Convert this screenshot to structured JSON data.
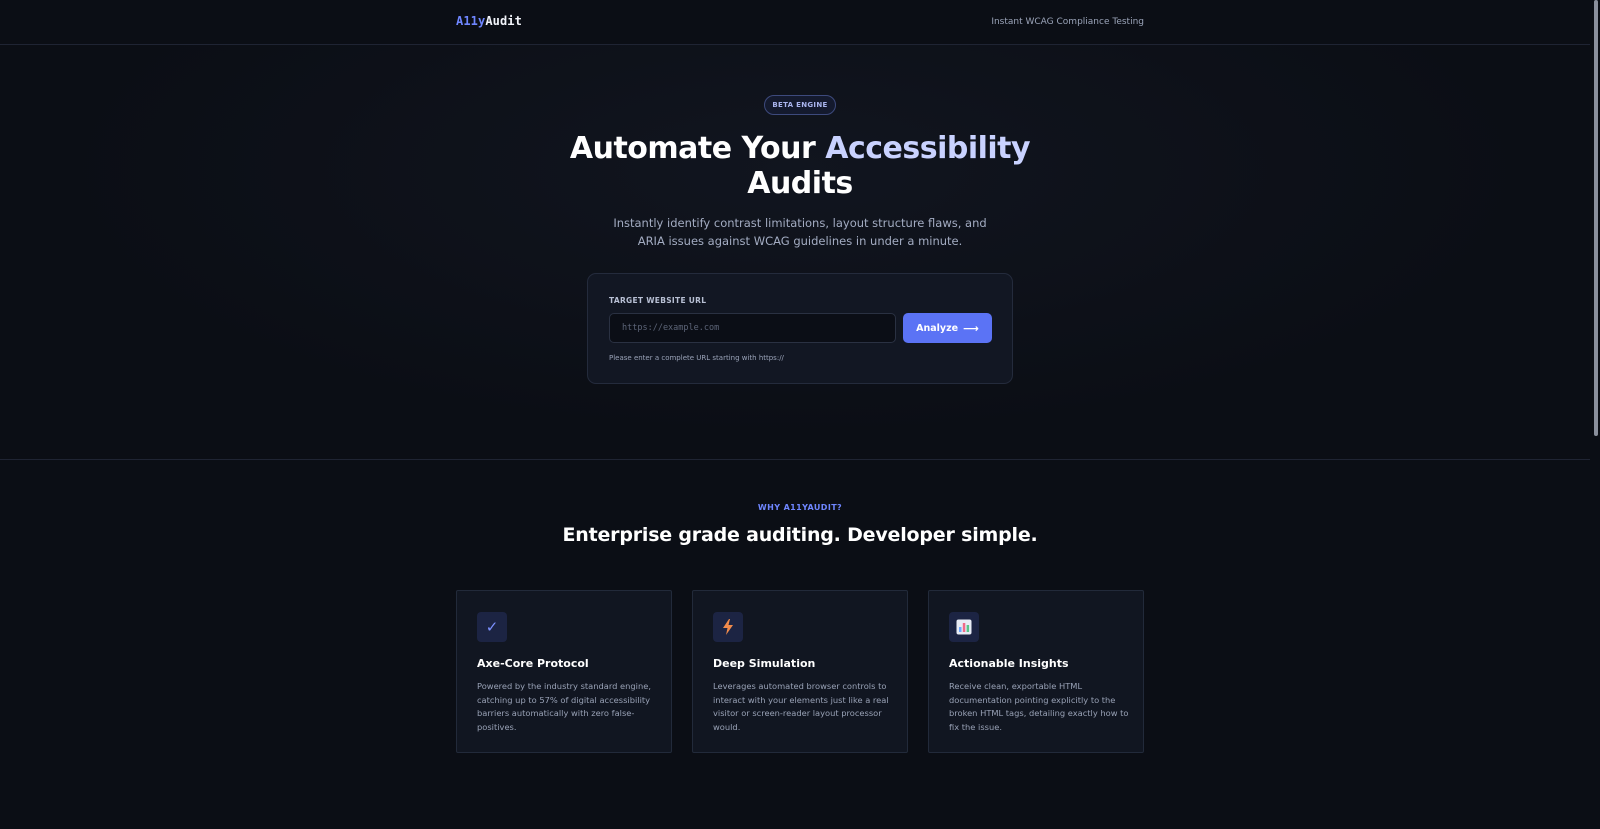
{
  "header": {
    "logo_part1": "A11y",
    "logo_part2": "Audit",
    "tagline": "Instant WCAG Compliance Testing"
  },
  "hero": {
    "badge": "BETA ENGINE",
    "headline_part1": "Automate Your ",
    "headline_highlight": "Accessibility",
    "headline_part2": "Audits",
    "subtitle": "Instantly identify contrast limitations, layout structure flaws, and ARIA issues against WCAG guidelines in under a minute."
  },
  "form": {
    "label": "TARGET WEBSITE URL",
    "value": "",
    "placeholder": "https://example.com",
    "button_label": "Analyze",
    "button_icon": "arrow-right-icon",
    "hint": "Please enter a complete URL starting with https://"
  },
  "features": {
    "eyebrow": "WHY A11YAUDIT?",
    "title": "Enterprise grade auditing. Developer simple.",
    "cards": [
      {
        "icon": "checkmark-icon",
        "title": "Axe-Core Protocol",
        "description": "Powered by the industry standard engine, catching up to 57% of digital accessibility barriers automatically with zero false-positives."
      },
      {
        "icon": "lightning-icon",
        "title": "Deep Simulation",
        "description": "Leverages automated browser controls to interact with your elements just like a real visitor or screen-reader layout processor would."
      },
      {
        "icon": "bar-chart-icon",
        "title": "Actionable Insights",
        "description": "Receive clean, exportable HTML documentation pointing explicitly to the broken HTML tags, detailing exactly how to fix the issue."
      }
    ]
  },
  "colors": {
    "background": "#0b0e15",
    "accent": "#5b73f5",
    "accent_text": "#6f86ff",
    "card_bg": "#111621"
  }
}
